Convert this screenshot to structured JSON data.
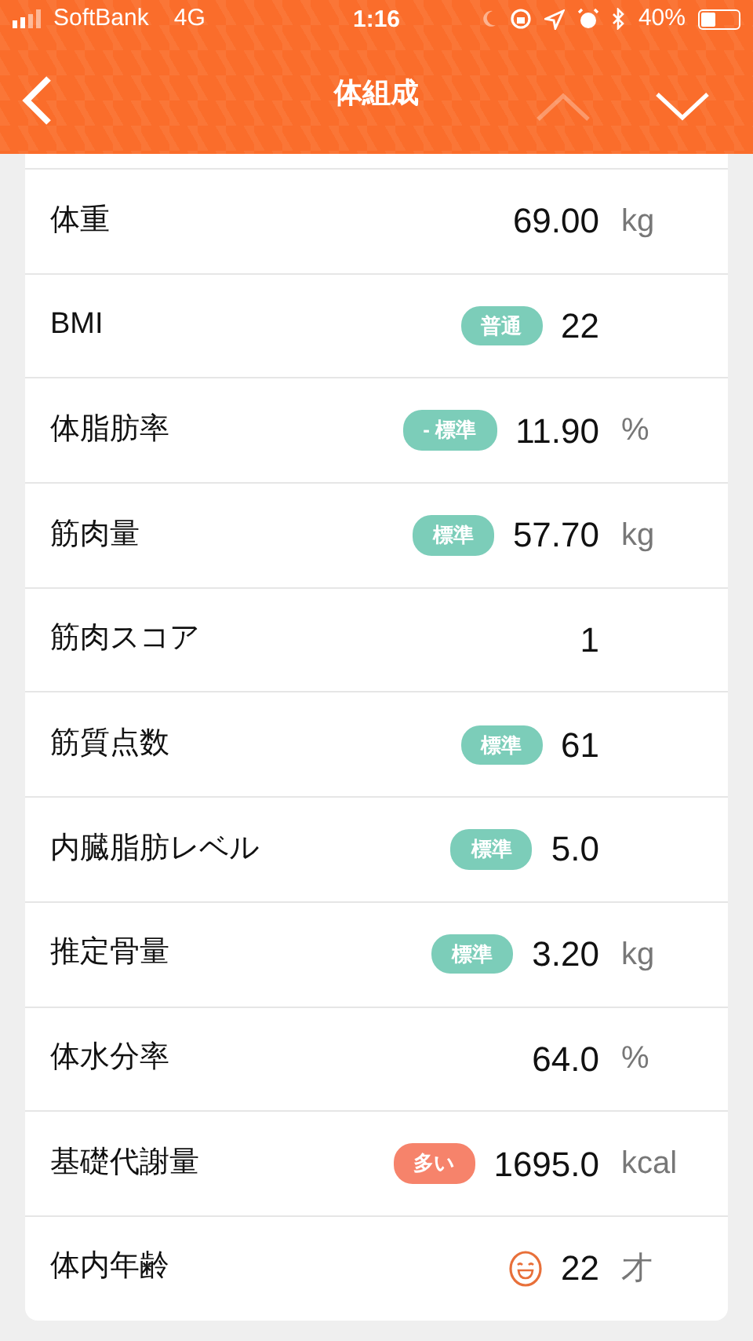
{
  "status_bar": {
    "carrier": "SoftBank",
    "network": "4G",
    "time": "1:16",
    "battery": "40%"
  },
  "nav": {
    "title": "体組成",
    "up": {
      "disabled": true
    },
    "down": {
      "disabled": false
    }
  },
  "rows": [
    {
      "label": "体重",
      "value": "69.00",
      "unit": "kg"
    },
    {
      "label": "BMI",
      "badge": {
        "kind": "tag",
        "text": "普通",
        "color": "#7ccdb9"
      },
      "value": "22"
    },
    {
      "label": "体脂肪率",
      "badge": {
        "kind": "tag",
        "text": "- 標準",
        "color": "#7ccdb9"
      },
      "value": "11.90",
      "unit": "%"
    },
    {
      "label": "筋肉量",
      "badge": {
        "kind": "tag",
        "text": "標準",
        "color": "#7ccdb9"
      },
      "value": "57.70",
      "unit": "kg"
    },
    {
      "label": "筋肉スコア",
      "value": "1"
    },
    {
      "label": "筋質点数",
      "badge": {
        "kind": "tag",
        "text": "標準",
        "color": "#7ccdb9"
      },
      "value": "61"
    },
    {
      "label": "内臓脂肪レベル",
      "badge": {
        "kind": "tag",
        "text": "標準",
        "color": "#7ccdb9"
      },
      "value": "5.0"
    },
    {
      "label": "推定骨量",
      "badge": {
        "kind": "tag",
        "text": "標準",
        "color": "#7ccdb9"
      },
      "value": "3.20",
      "unit": "kg"
    },
    {
      "label": "体水分率",
      "value": "64.0",
      "unit": "%"
    },
    {
      "label": "基礎代謝量",
      "badge": {
        "kind": "tag",
        "text": "多い",
        "color": "#f6836b"
      },
      "value": "1695.0",
      "unit": "kcal"
    },
    {
      "label": "体内年齢",
      "badge": {
        "kind": "face",
        "color": "#e8703a"
      },
      "value": "22",
      "unit": "才"
    }
  ]
}
